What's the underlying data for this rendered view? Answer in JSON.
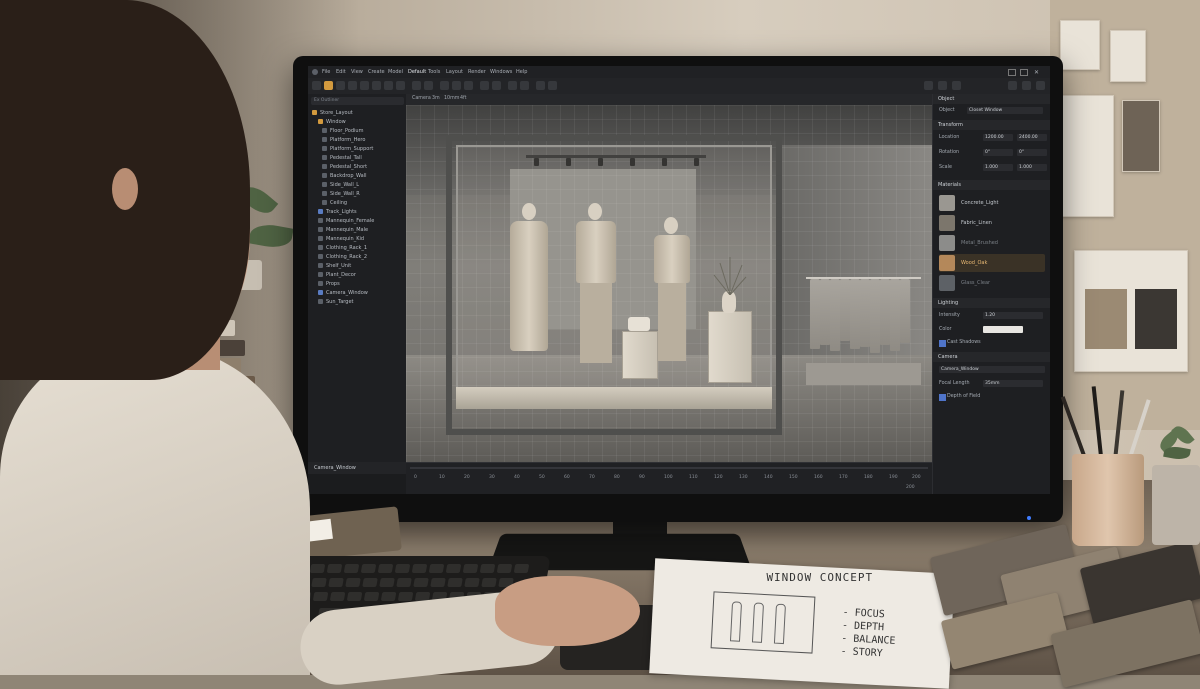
{
  "app": {
    "menu": [
      "File",
      "Edit",
      "View",
      "Create",
      "Model",
      "Default",
      "Tools",
      "Layout",
      "Render",
      "Windows",
      "Help"
    ]
  },
  "outliner": {
    "search_placeholder": "Ex Outliner",
    "items": [
      {
        "label": "Store_Layout",
        "icon": "folder-icon"
      },
      {
        "label": "Window",
        "icon": "folder-icon"
      },
      {
        "label": "Floor_Podium",
        "icon": "mesh-icon"
      },
      {
        "label": "Platform_Hero",
        "icon": "mesh-icon"
      },
      {
        "label": "Platform_Support",
        "icon": "mesh-icon"
      },
      {
        "label": "Pedestal_Tall",
        "icon": "mesh-icon"
      },
      {
        "label": "Pedestal_Short",
        "icon": "mesh-icon"
      },
      {
        "label": "Backdrop_Wall",
        "icon": "mesh-icon"
      },
      {
        "label": "Side_Wall_L",
        "icon": "mesh-icon"
      },
      {
        "label": "Side_Wall_R",
        "icon": "mesh-icon"
      },
      {
        "label": "Ceiling",
        "icon": "mesh-icon"
      },
      {
        "label": "Track_Lights",
        "icon": "light-icon"
      },
      {
        "label": "Mannequin_Female",
        "icon": "mesh-icon"
      },
      {
        "label": "Mannequin_Male",
        "icon": "mesh-icon"
      },
      {
        "label": "Mannequin_Kid",
        "icon": "mesh-icon"
      },
      {
        "label": "Clothing_Rack_1",
        "icon": "mesh-icon"
      },
      {
        "label": "Clothing_Rack_2",
        "icon": "mesh-icon"
      },
      {
        "label": "Shelf_Unit",
        "icon": "mesh-icon"
      },
      {
        "label": "Plant_Decor",
        "icon": "mesh-icon"
      },
      {
        "label": "Props",
        "icon": "folder-icon"
      },
      {
        "label": "Camera_Window",
        "icon": "camera-icon"
      },
      {
        "label": "Sun_Target",
        "icon": "target-icon"
      }
    ],
    "footer": "Camera_Window"
  },
  "viewport": {
    "tabs": [
      "Camera",
      "3m",
      "10mm",
      "4ft"
    ],
    "timeline_ticks": [
      "0",
      "10",
      "20",
      "30",
      "40",
      "50",
      "60",
      "70",
      "80",
      "90",
      "100",
      "110",
      "120",
      "130",
      "140",
      "150",
      "160",
      "170",
      "180",
      "190",
      "200"
    ],
    "timeline_end": "200"
  },
  "properties": {
    "header": "Object",
    "object_label": "Object",
    "object_name": "Closet Window",
    "transform": {
      "title": "Transform",
      "location_label": "Location",
      "location": [
        "1200.00",
        "2400.00"
      ],
      "rotation_label": "Rotation",
      "rotation": [
        "0°",
        "0°"
      ],
      "scale_label": "Scale",
      "scale": [
        "1.000",
        "1.000"
      ]
    },
    "materials": {
      "title": "Materials",
      "items": [
        {
          "label": "Concrete_Light",
          "color": "#9a9791"
        },
        {
          "label": "Fabric_Linen",
          "color": "#7c766c"
        },
        {
          "label": "Metal_Brushed",
          "color": "#8c8c8a"
        },
        {
          "label": "Wood_Oak",
          "color": "#b4885a",
          "active": true
        },
        {
          "label": "Glass_Clear",
          "color": "#5d6166"
        }
      ]
    },
    "lighting": {
      "title": "Lighting",
      "intensity_label": "Intensity",
      "intensity": "1.20",
      "color_label": "Color",
      "color": "#e8e6e2",
      "cast_shadows_label": "Cast Shadows",
      "cast_shadows": true
    },
    "camera": {
      "title": "Camera",
      "name": "Camera_Window",
      "focal_length_label": "Focal Length",
      "focal_length": "35mm",
      "dof_label": "Depth of Field",
      "dof": true
    }
  },
  "desk_paper": {
    "title": "WINDOW CONCEPT",
    "list": [
      "- FOCUS",
      "- DEPTH",
      "- BALANCE",
      "- STORY"
    ]
  }
}
